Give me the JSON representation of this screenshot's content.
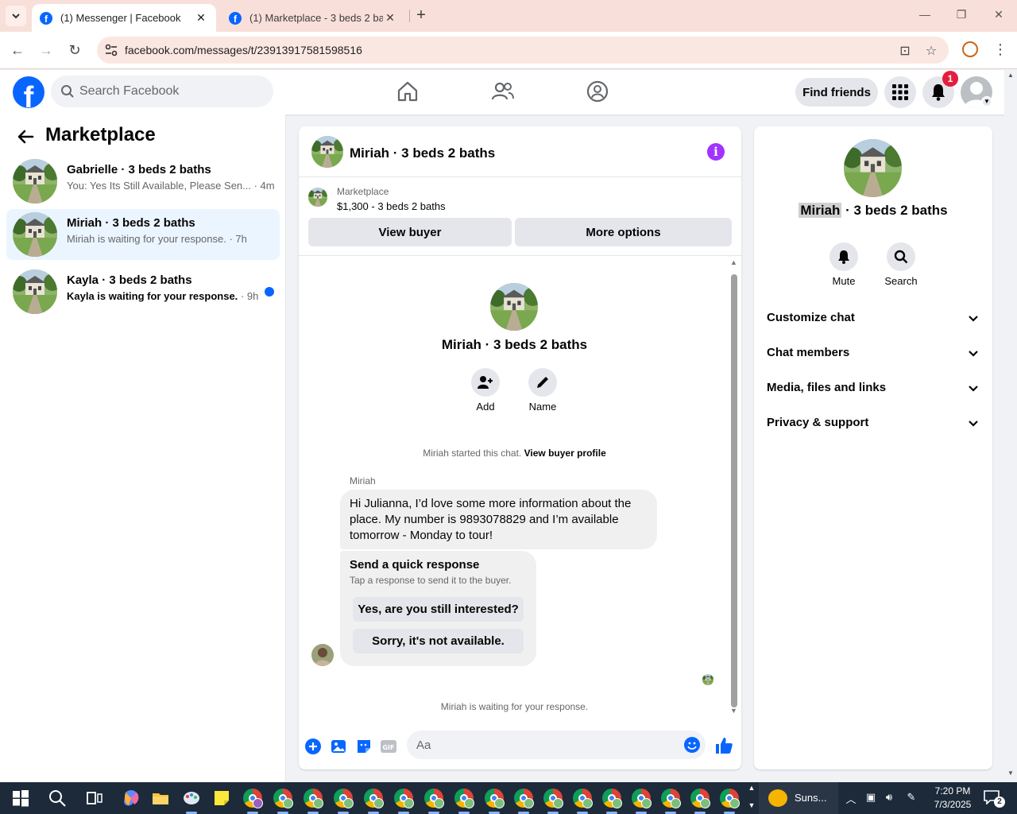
{
  "browser": {
    "tabs": [
      {
        "title": "(1) Messenger | Facebook",
        "active": true
      },
      {
        "title": "(1) Marketplace - 3 beds 2 bath",
        "active": false
      }
    ],
    "url": "facebook.com/messages/t/23913917581598516"
  },
  "fb_header": {
    "search_placeholder": "Search Facebook",
    "find_friends_label": "Find friends",
    "notification_count": "1",
    "brand_color": "#0866ff"
  },
  "left_panel": {
    "title": "Marketplace",
    "conversations": [
      {
        "name": "Gabrielle · 3 beds 2 baths",
        "preview": "You: Yes Its Still Available, Please Sen...",
        "time": " · 4m",
        "selected": false,
        "unread": false
      },
      {
        "name": "Miriah · 3 beds 2 baths",
        "preview": "Miriah is waiting for your response.",
        "time": " · 7h",
        "selected": true,
        "unread": false
      },
      {
        "name": "Kayla · 3 beds 2 baths",
        "preview": "Kayla is waiting for your response.",
        "time": " · 9h",
        "selected": false,
        "unread": true
      }
    ]
  },
  "chat": {
    "title": "Miriah · 3 beds 2 baths",
    "marketplace_label": "Marketplace",
    "listing": "$1,300 - 3 beds 2 baths",
    "view_buyer_label": "View buyer",
    "more_options_label": "More options",
    "intro_name": "Miriah · 3 beds 2 baths",
    "add_label": "Add",
    "name_label": "Name",
    "started_note": "Miriah started this chat. ",
    "view_buyer_profile": "View buyer profile",
    "sender": "Miriah",
    "message": "Hi Julianna, I’d love some more information about the place. My number is 9893078829 and I’m available tomorrow - Monday to tour!",
    "quick_title": "Send a quick response",
    "quick_subtitle": "Tap a response to send it to the buyer.",
    "quick_replies": [
      "Yes, are you still interested?",
      "Sorry, it's not available."
    ],
    "waiting_note": "Miriah is waiting for your response.",
    "composer_placeholder": "Aa",
    "accent_color": "#0866ff"
  },
  "right_panel": {
    "name_highlight": "Miriah",
    "name_rest": " · 3 beds 2 baths",
    "mute_label": "Mute",
    "search_label": "Search",
    "sections": [
      "Customize chat",
      "Chat members",
      "Media, files and links",
      "Privacy & support"
    ]
  },
  "taskbar": {
    "weather": "Suns...",
    "time": "7:20 PM",
    "date": "7/3/2025",
    "notification_count": "2"
  }
}
